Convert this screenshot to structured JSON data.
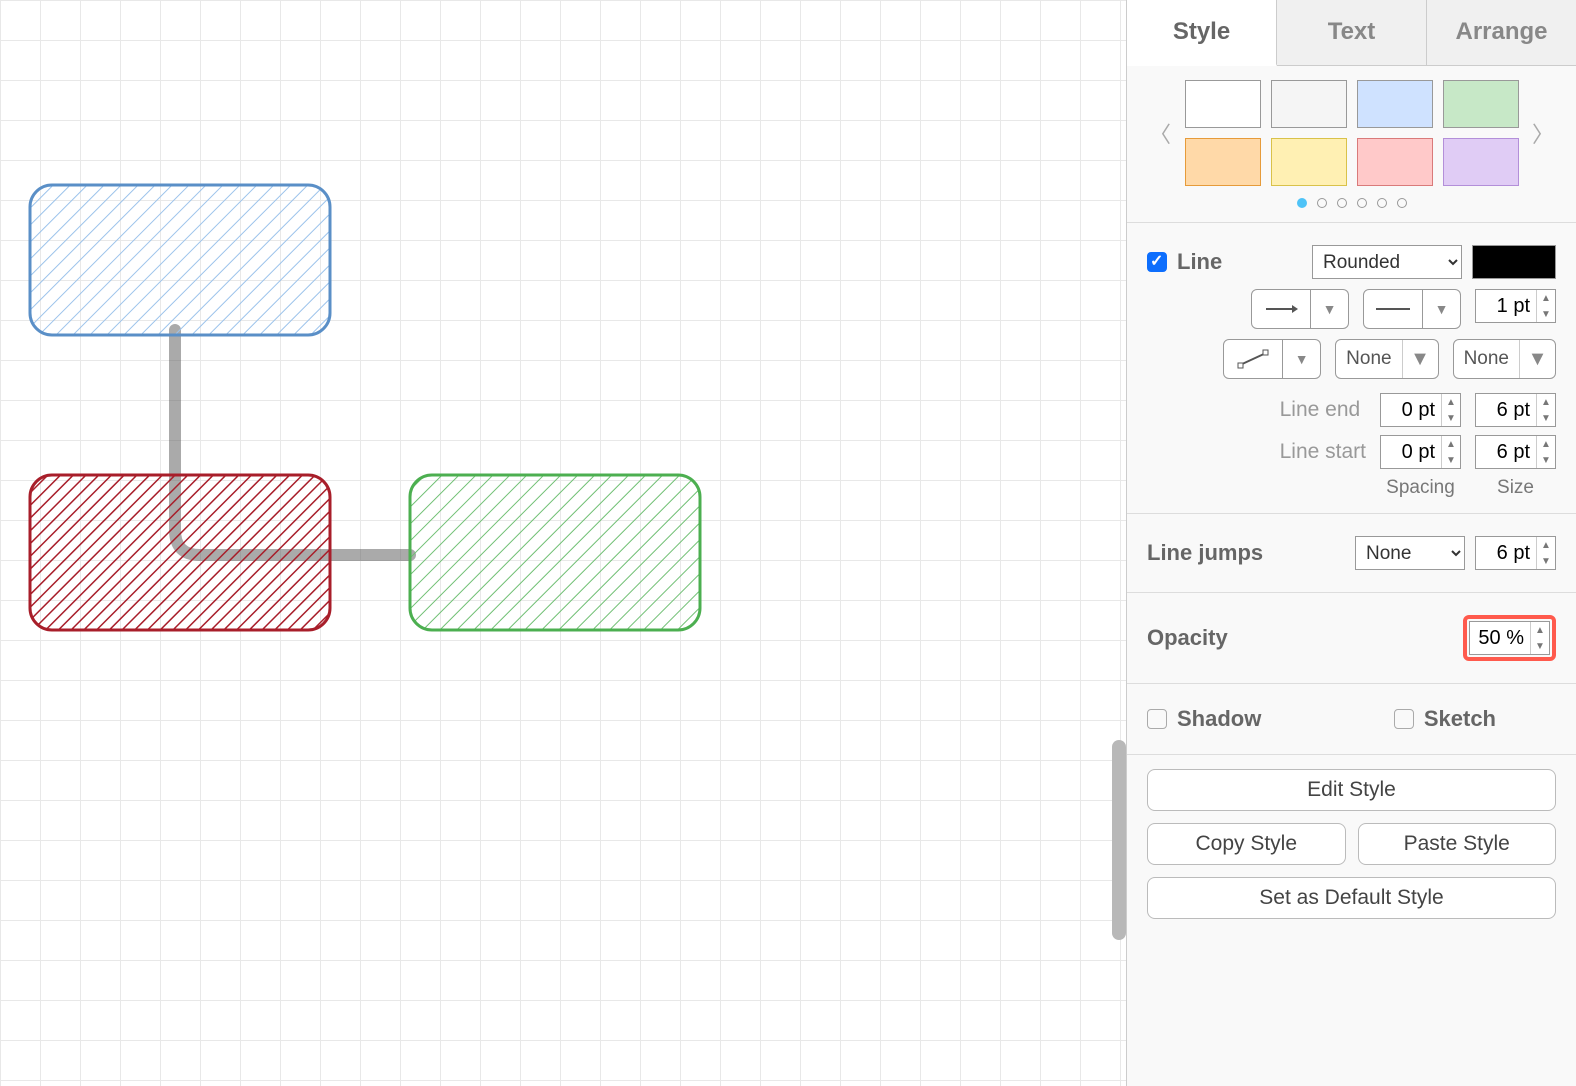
{
  "tabs": {
    "style": "Style",
    "text": "Text",
    "arrange": "Arrange"
  },
  "palette": {
    "colors": [
      "#ffffff",
      "#f5f5f5",
      "#cfe2ff",
      "#c7e8c7",
      "#ffd9a8",
      "#fff0b3",
      "#ffc9c9",
      "#e0ccf5"
    ]
  },
  "line": {
    "label": "Line",
    "style_value": "Rounded",
    "width_value": "1 pt",
    "waypoint_none": "None",
    "connection_none": "None",
    "end_label": "Line end",
    "start_label": "Line start",
    "end_spacing": "0 pt",
    "end_size": "6 pt",
    "start_spacing": "0 pt",
    "start_size": "6 pt",
    "spacing_label": "Spacing",
    "size_label": "Size"
  },
  "linejumps": {
    "label": "Line jumps",
    "value": "None",
    "size": "6 pt"
  },
  "opacity": {
    "label": "Opacity",
    "value": "50 %"
  },
  "shadow": {
    "label": "Shadow"
  },
  "sketch": {
    "label": "Sketch"
  },
  "buttons": {
    "edit_style": "Edit Style",
    "copy_style": "Copy Style",
    "paste_style": "Paste Style",
    "set_default": "Set as Default Style"
  }
}
